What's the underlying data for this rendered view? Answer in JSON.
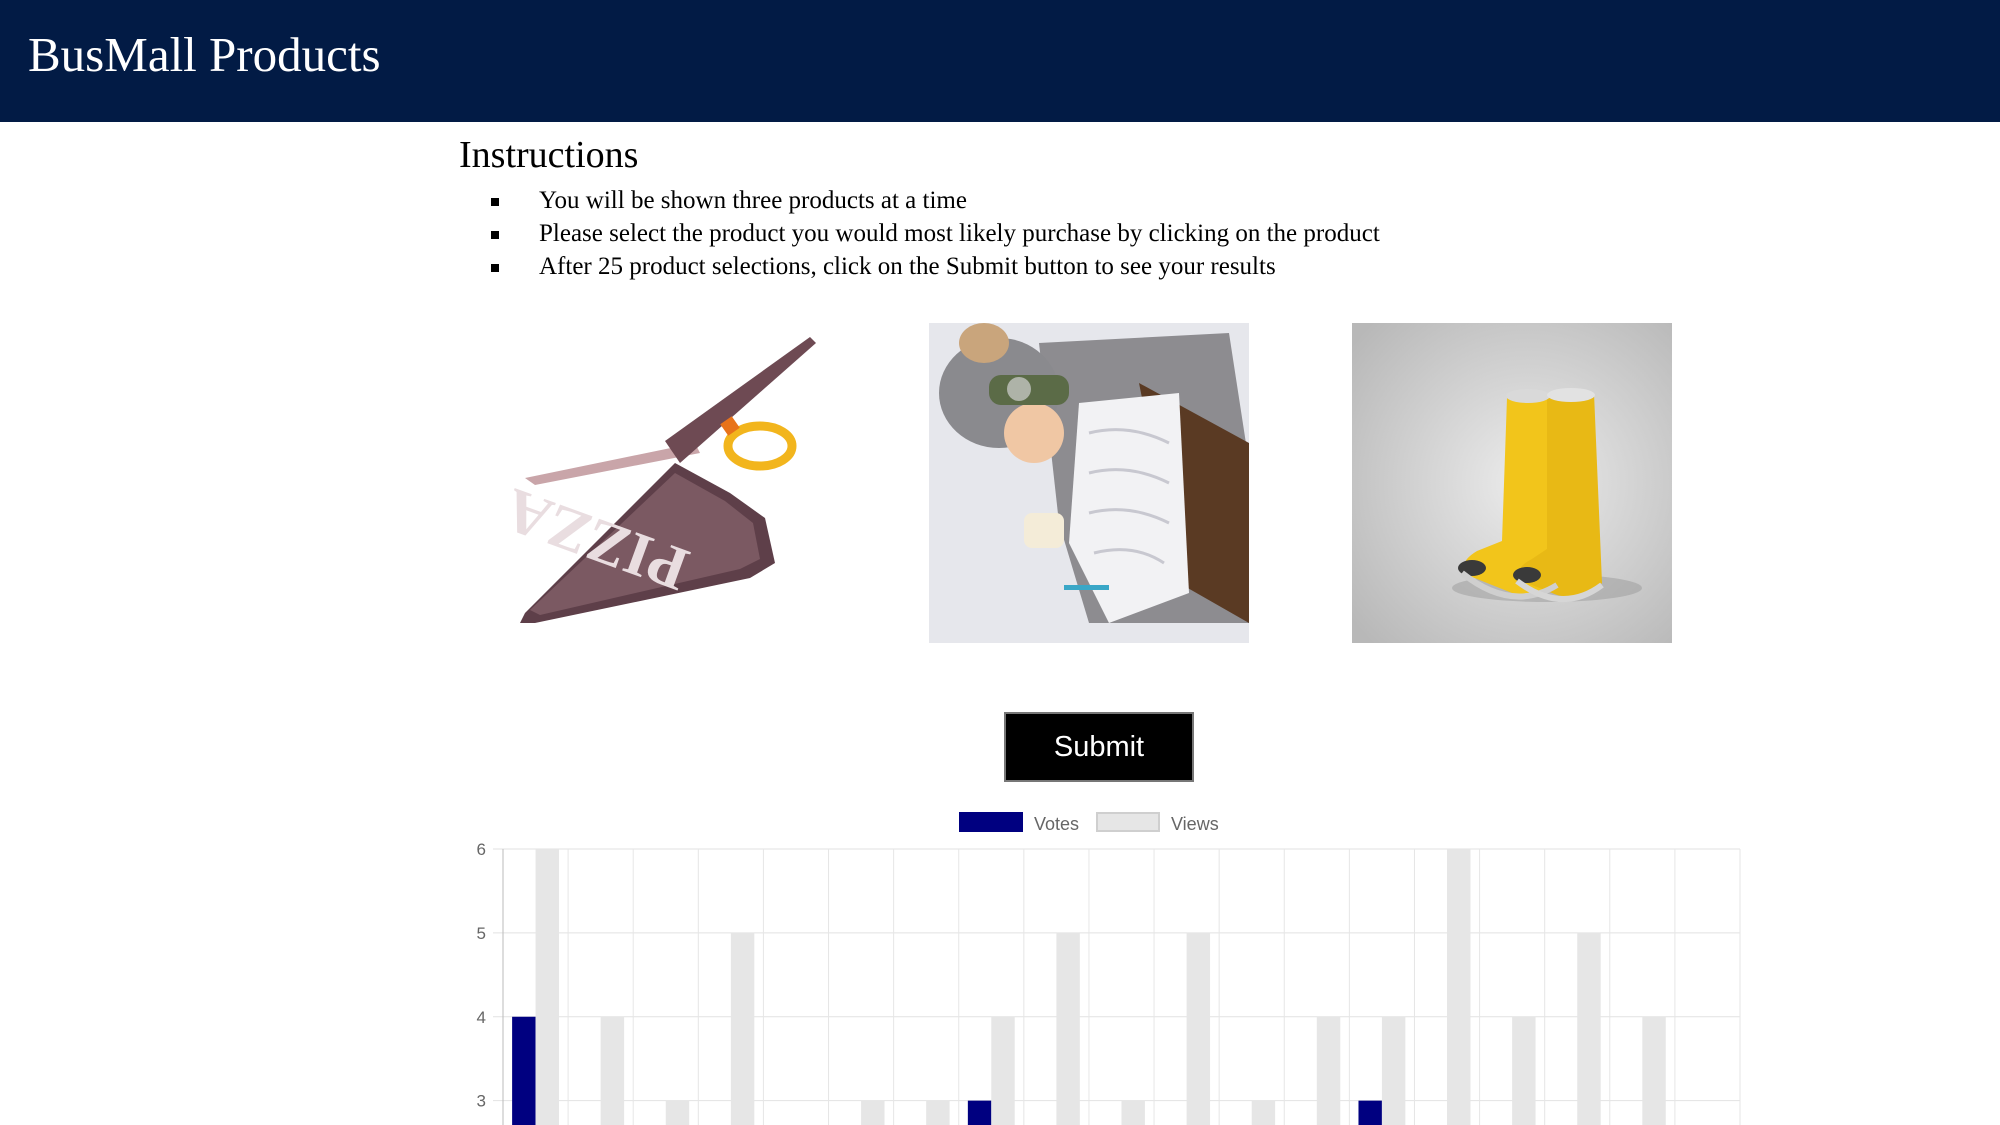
{
  "header": {
    "title": "BusMall Products"
  },
  "instructions": {
    "heading": "Instructions",
    "items": [
      "You will be shown three products at a time",
      "Please select the product you would most likely purchase by clicking on the product",
      "After 25 product selections, click on the Submit button to see your results"
    ]
  },
  "products": [
    {
      "icon": "pizza-scissors-image"
    },
    {
      "icon": "tauntaun-sleeping-bag-image"
    },
    {
      "icon": "yellow-boots-image"
    }
  ],
  "submit": {
    "label": "Submit"
  },
  "colors": {
    "header_bg": "#021b45",
    "votes": "#000080",
    "views": "#e6e6e6"
  },
  "chart_data": {
    "type": "bar",
    "legend": [
      "Votes",
      "Views"
    ],
    "legend_position": "top",
    "grid": true,
    "y_visible_range": [
      2.65,
      6
    ],
    "yticks": [
      3,
      4,
      5,
      6
    ],
    "series": [
      {
        "name": "Votes",
        "values": [
          4,
          0,
          0,
          0,
          0,
          0,
          0,
          3,
          0,
          0,
          0,
          0,
          0,
          3,
          0,
          0,
          0,
          0,
          0
        ]
      },
      {
        "name": "Views",
        "values": [
          6,
          4,
          3,
          5,
          0,
          3,
          3,
          4,
          5,
          3,
          5,
          3,
          4,
          4,
          6,
          4,
          5,
          4,
          0
        ]
      }
    ]
  }
}
